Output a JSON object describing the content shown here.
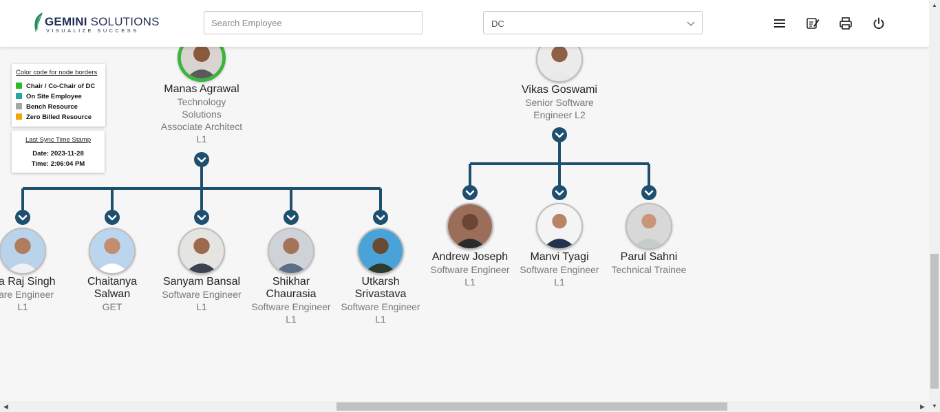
{
  "header": {
    "brand_name": "GEMINI",
    "brand_name_rest": "SOLUTIONS",
    "brand_tagline": "VISUALIZE SUCCESS",
    "search_placeholder": "Search Employee",
    "dc_selected": "DC",
    "icons": [
      "menu-icon",
      "edit-note-icon",
      "print-icon",
      "power-icon"
    ]
  },
  "legend": {
    "title": "Color code for node borders",
    "items": [
      {
        "label": "Chair / Co-Chair of DC",
        "color": "#2eb82e"
      },
      {
        "label": "On Site Employee",
        "color": "#2aa3a3"
      },
      {
        "label": "Bench Resource",
        "color": "#a6a6a6"
      },
      {
        "label": "Zero Billed Resource",
        "color": "#f0a500"
      }
    ]
  },
  "sync": {
    "title": "Last Sync Time Stamp",
    "date": "Date: 2023-11-28",
    "time": "Time: 2:06:04 PM"
  },
  "colors": {
    "connector": "#1e4f6e",
    "chair_border": "#3cb53c"
  },
  "nodes": {
    "manas": {
      "name": "Manas Agrawal",
      "role_1": "Technology",
      "role_2": "Solutions",
      "role_3": "Associate Architect",
      "role_4": "L1"
    },
    "vikas": {
      "name": "Vikas Goswami",
      "role_1": "Senior Software",
      "role_2": "Engineer L2"
    },
    "aditya": {
      "name": "tya Raj Singh",
      "role_1": "ware Engineer",
      "role_2": "L1"
    },
    "chaitanya": {
      "name_1": "Chaitanya",
      "name_2": "Salwan",
      "role_1": "GET"
    },
    "sanyam": {
      "name": "Sanyam Bansal",
      "role_1": "Software Engineer",
      "role_2": "L1"
    },
    "shikhar": {
      "name_1": "Shikhar",
      "name_2": "Chaurasia",
      "role_1": "Software Engineer",
      "role_2": "L1"
    },
    "utkarsh": {
      "name_1": "Utkarsh",
      "name_2": "Srivastava",
      "role_1": "Software Engineer",
      "role_2": "L1"
    },
    "andrew": {
      "name": "Andrew Joseph",
      "role_1": "Software Engineer",
      "role_2": "L1"
    },
    "manvi": {
      "name": "Manvi Tyagi",
      "role_1": "Software Engineer",
      "role_2": "L1"
    },
    "parul": {
      "name": "Parul Sahni",
      "role_1": "Technical Trainee"
    }
  }
}
